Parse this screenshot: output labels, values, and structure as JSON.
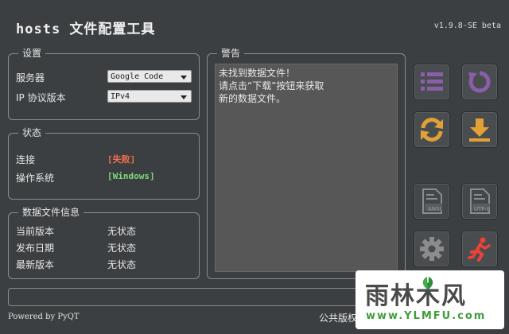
{
  "window": {
    "title": "hosts 文件配置工具",
    "version": "v1.9.8-SE beta"
  },
  "settings": {
    "title": "设置",
    "server_label": "服务器",
    "server_value": "Google Code",
    "ip_label": "IP 协议版本",
    "ip_value": "IPv4"
  },
  "status": {
    "title": "状态",
    "connection_label": "连接",
    "connection_value": "[失败]",
    "os_label": "操作系统",
    "os_value": "[Windows]"
  },
  "datafile": {
    "title": "数据文件信息",
    "current_label": "当前版本",
    "current_value": "无状态",
    "release_label": "发布日期",
    "release_value": "无状态",
    "latest_label": "最新版本",
    "latest_value": "无状态"
  },
  "warning": {
    "title": "警告",
    "line1": "未找到数据文件！",
    "line2": "请点击“下载”按钮来获取",
    "line3": "新的数据文件。"
  },
  "buttons": {
    "list_icon": "list-icon",
    "reset_icon": "rotate-icon",
    "refresh_icon": "refresh-icon",
    "download_icon": "download-icon",
    "ansi_label": "ANSI",
    "utf8_label": "UTF-8",
    "settings_icon": "gear-icon",
    "exit_icon": "running-man-icon"
  },
  "footer": {
    "powered": "Powered by PyQT",
    "license": "公共版权"
  },
  "watermark": {
    "brand": "雨林木风",
    "url": "www.YLMFU.com"
  },
  "colors": {
    "accent_purple": "#8a5ea8",
    "accent_orange": "#e2a136",
    "accent_red": "#ef4135",
    "fail": "#f0704f",
    "ok": "#7dd97a"
  }
}
